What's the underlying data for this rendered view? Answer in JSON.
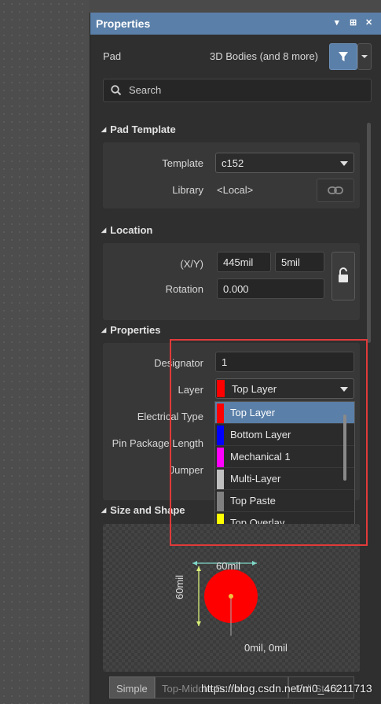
{
  "panel": {
    "title": "Properties",
    "controls": [
      "▾",
      "⊞",
      "✕"
    ],
    "object_type": "Pad",
    "filter_summary": "3D Bodies (and 8 more)",
    "search_placeholder": "Search"
  },
  "sections": {
    "pad_template": {
      "title": "Pad Template",
      "template_label": "Template",
      "template_value": "c152",
      "library_label": "Library",
      "library_value": "<Local>"
    },
    "location": {
      "title": "Location",
      "xy_label": "(X/Y)",
      "x_value": "445mil",
      "y_value": "5mil",
      "rotation_label": "Rotation",
      "rotation_value": "0.000"
    },
    "properties": {
      "title": "Properties",
      "designator_label": "Designator",
      "designator_value": "1",
      "layer_label": "Layer",
      "layer_value": "Top Layer",
      "layer_color": "#ff0000",
      "electrical_type_label": "Electrical Type",
      "pin_package_length_label": "Pin Package Length",
      "jumper_label": "Jumper"
    },
    "size_and_shape": {
      "title": "Size and Shape",
      "width_dim": "60mil",
      "height_dim": "60mil",
      "offset_label": "0mil, 0mil",
      "tabs": [
        "Simple",
        "Top-Middle-Bottom",
        "Full Stack"
      ]
    }
  },
  "layer_dropdown": {
    "options": [
      {
        "label": "Top Layer",
        "color": "#ff0000",
        "selected": true
      },
      {
        "label": "Bottom Layer",
        "color": "#0000ff",
        "selected": false
      },
      {
        "label": "Mechanical 1",
        "color": "#ff00ff",
        "selected": false
      },
      {
        "label": "Multi-Layer",
        "color": "#c0c0c0",
        "selected": false
      },
      {
        "label": "Top Paste",
        "color": "#808080",
        "selected": false
      },
      {
        "label": "Top Overlay",
        "color": "#ffff00",
        "selected": false
      }
    ]
  },
  "watermark": "https://blog.csdn.net/m0_46211713"
}
